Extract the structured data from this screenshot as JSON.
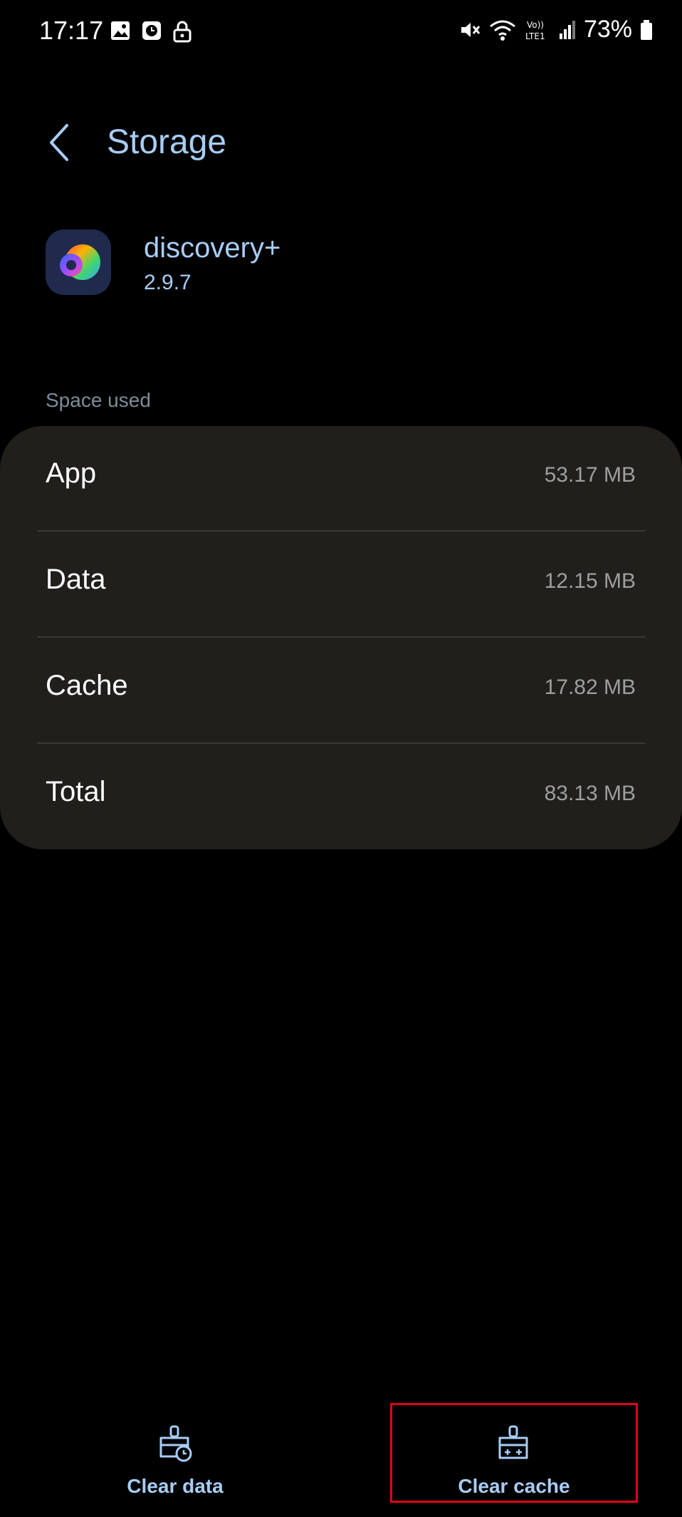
{
  "status_bar": {
    "time": "17:17",
    "battery": "73%"
  },
  "header": {
    "title": "Storage"
  },
  "app": {
    "name": "discovery+",
    "version": "2.9.7"
  },
  "space_used": {
    "label": "Space used",
    "rows": [
      {
        "label": "App",
        "value": "53.17 MB"
      },
      {
        "label": "Data",
        "value": "12.15 MB"
      },
      {
        "label": "Cache",
        "value": "17.82 MB"
      },
      {
        "label": "Total",
        "value": "83.13 MB"
      }
    ]
  },
  "actions": {
    "clear_data": "Clear data",
    "clear_cache": "Clear cache"
  },
  "colors": {
    "accent": "#a8cdf5",
    "card_bg": "#201f1b",
    "highlight": "#e0001b"
  }
}
